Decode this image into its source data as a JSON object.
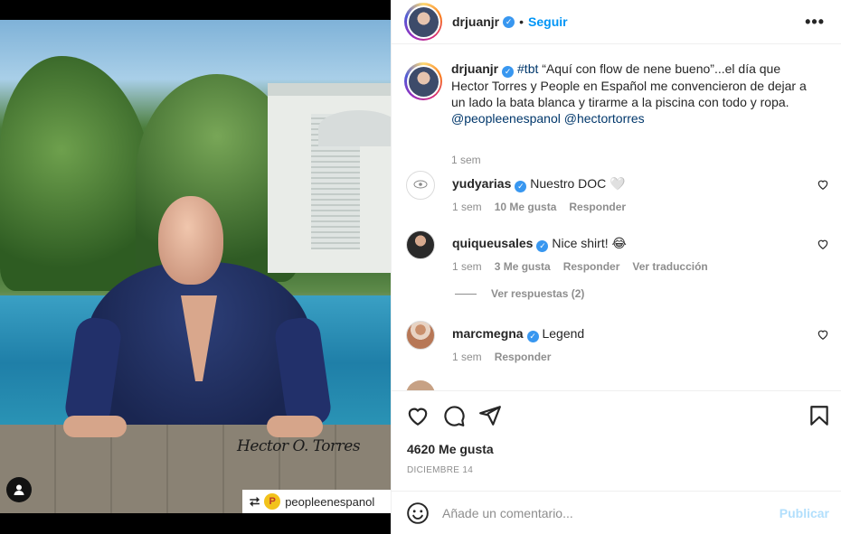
{
  "post": {
    "author": "drjuanjr",
    "follow_label": "Seguir",
    "separator": "•",
    "more_label": "•••"
  },
  "media": {
    "signature": "Hector O. Torres",
    "repost_account": "peopleenespanol"
  },
  "caption": {
    "author": "drjuanjr",
    "hashtag": "#tbt",
    "text": " “Aquí con flow de nene bueno”...el día que Hector Torres y People en Español me convencieron de dejar a un lado la bata blanca y tirarme a la piscina con todo y ropa. ",
    "mention_1": "@peopleenespanol",
    "mention_2": "@hectortorres",
    "time": "1 sem"
  },
  "comments": [
    {
      "user": "yudyarias",
      "text": "Nuestro DOC 🤍",
      "time": "1 sem",
      "likes": "10 Me gusta",
      "reply": "Responder",
      "translate": ""
    },
    {
      "user": "quiqueusales",
      "text": "Nice shirt! 😂",
      "time": "1 sem",
      "likes": "3 Me gusta",
      "reply": "Responder",
      "translate": "Ver traducción"
    },
    {
      "user": "marcmegna",
      "text": "Legend",
      "time": "1 sem",
      "likes": "",
      "reply": "Responder",
      "translate": ""
    }
  ],
  "view_replies": "Ver respuestas (2)",
  "actions": {
    "likes": "4620 Me gusta",
    "date": "DICIEMBRE 14"
  },
  "composer": {
    "placeholder": "Añade un comentario...",
    "publish": "Publicar"
  },
  "colors": {
    "accent": "#0095f6",
    "verified": "#3897f0",
    "muted": "#8e8e8e",
    "publish_disabled": "#b2dffc"
  }
}
